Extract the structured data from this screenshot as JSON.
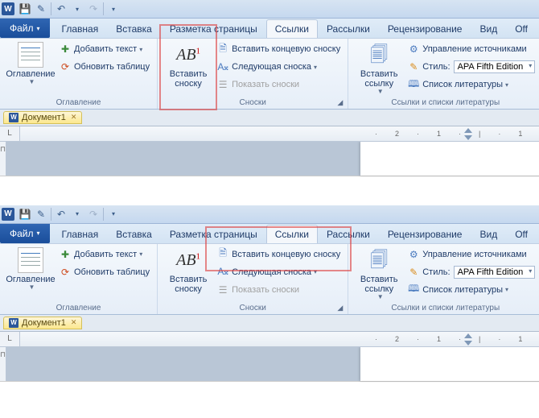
{
  "tabs": {
    "file": "Файл",
    "home": "Главная",
    "insert": "Вставка",
    "layout": "Разметка страницы",
    "references": "Ссылки",
    "mailings": "Рассылки",
    "review": "Рецензирование",
    "view": "Вид",
    "off": "Off"
  },
  "groups": {
    "toc": {
      "label": "Оглавление",
      "toc_btn": "Оглавление",
      "add_text": "Добавить текст",
      "update_table": "Обновить таблицу"
    },
    "footnotes": {
      "label": "Сноски",
      "insert_footnote": "Вставить\nсноску",
      "insert_endnote": "Вставить концевую сноску",
      "next_footnote": "Следующая сноска",
      "show_notes": "Показать сноски"
    },
    "citations": {
      "label": "Ссылки и списки литературы",
      "insert_citation": "Вставить\nссылку",
      "manage_sources": "Управление источниками",
      "style_label": "Стиль:",
      "style_value": "APA Fifth Edition",
      "bibliography": "Список литературы"
    }
  },
  "doc_tab": "Документ1",
  "ruler_marks": [
    "2",
    "1",
    "1",
    "2"
  ],
  "ruler_corner": "L",
  "word_letter": "W"
}
